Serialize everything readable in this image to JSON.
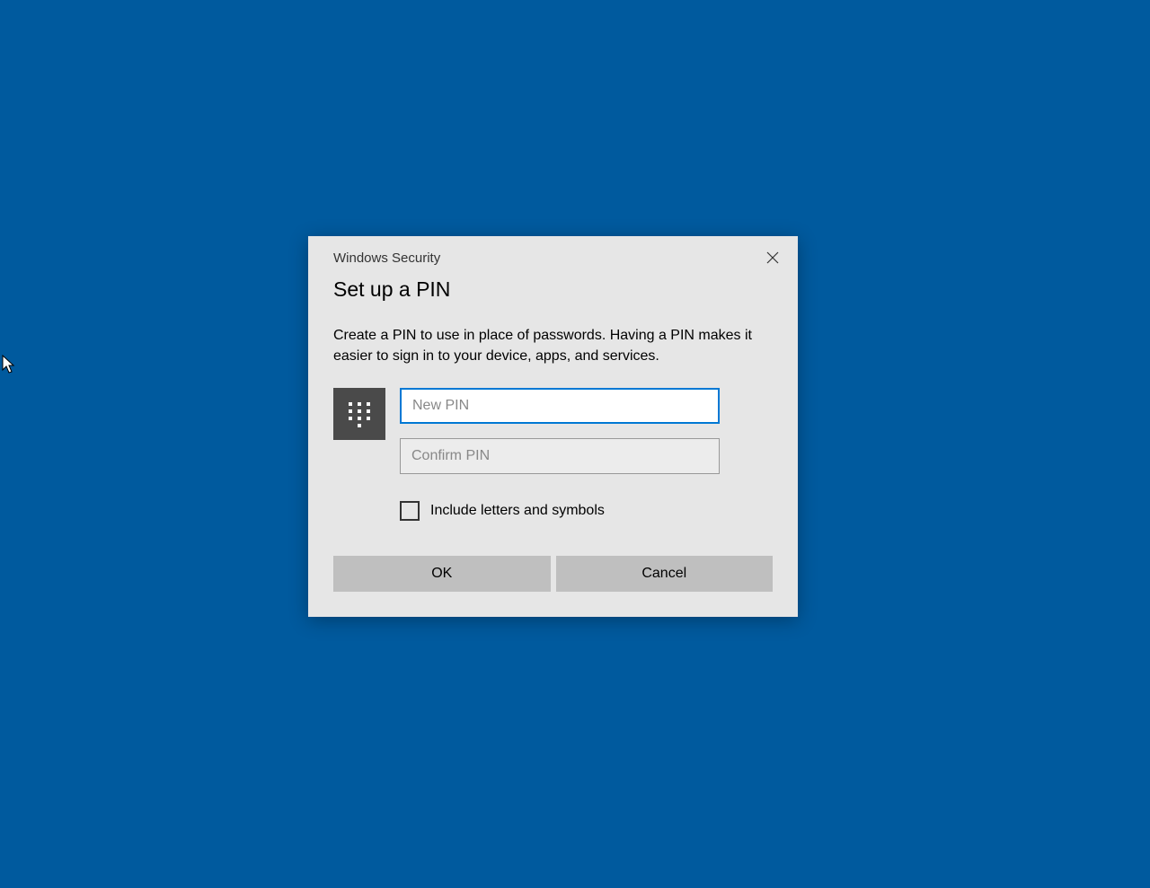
{
  "dialog": {
    "source": "Windows Security",
    "title": "Set up a PIN",
    "description": "Create a PIN to use in place of passwords. Having a PIN makes it easier to sign in to your device, apps, and services.",
    "new_pin_placeholder": "New PIN",
    "new_pin_value": "",
    "confirm_pin_placeholder": "Confirm PIN",
    "confirm_pin_value": "",
    "checkbox_label": "Include letters and symbols",
    "checkbox_checked": false,
    "ok_label": "OK",
    "cancel_label": "Cancel"
  }
}
